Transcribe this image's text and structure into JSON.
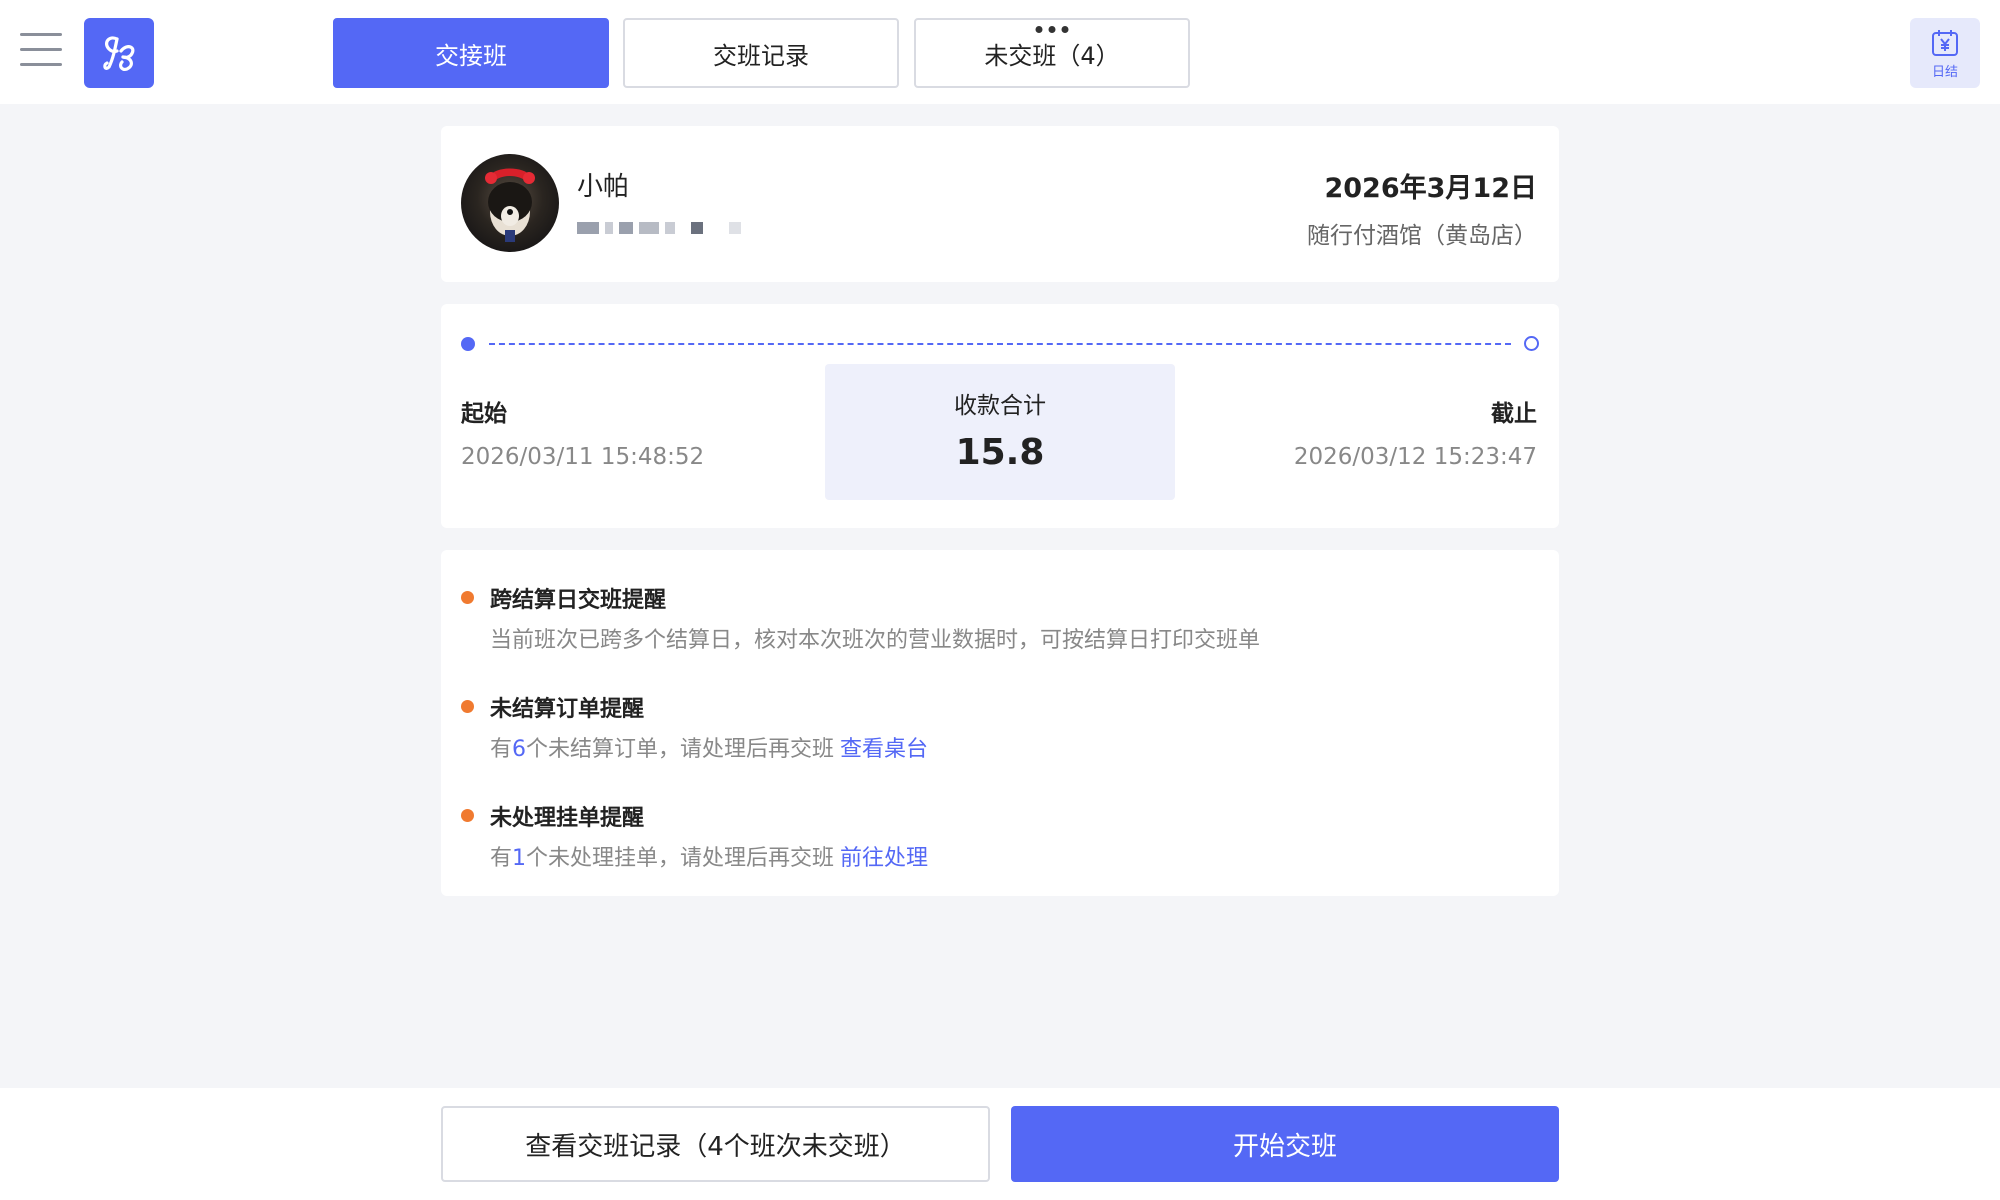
{
  "header": {
    "tabs": [
      {
        "label": "交接班",
        "active": true
      },
      {
        "label": "交班记录",
        "active": false
      },
      {
        "label": "未交班（4）",
        "active": false
      }
    ],
    "daily_button_label": "日结",
    "menu_icon": "hamburger-menu-icon",
    "logo_icon": "butterfly-logo-icon",
    "calendar_icon": "calendar-yen-icon"
  },
  "profile": {
    "name": "小帕",
    "date": "2026年3月12日",
    "store": "随行付酒馆（黄岛店）"
  },
  "range": {
    "start_label": "起始",
    "start_time": "2026/03/11 15:48:52",
    "total_label": "收款合计",
    "total_value": "15.8",
    "end_label": "截止",
    "end_time": "2026/03/12 15:23:47"
  },
  "notices": [
    {
      "title": "跨结算日交班提醒",
      "desc": "当前班次已跨多个结算日，核对本次班次的营业数据时，可按结算日打印交班单"
    },
    {
      "title": "未结算订单提醒",
      "desc_prefix": "有",
      "count": "6",
      "desc_suffix": "个未结算订单，请处理后再交班",
      "link": "查看桌台"
    },
    {
      "title": "未处理挂单提醒",
      "desc_prefix": "有",
      "count": "1",
      "desc_suffix": "个未处理挂单，请处理后再交班",
      "link": "前往处理"
    }
  ],
  "footer": {
    "records_button": "查看交班记录（4个班次未交班）",
    "start_button": "开始交班"
  },
  "colors": {
    "accent": "#5468f5",
    "warning_dot": "#f07a30",
    "background": "#f4f5f8"
  }
}
